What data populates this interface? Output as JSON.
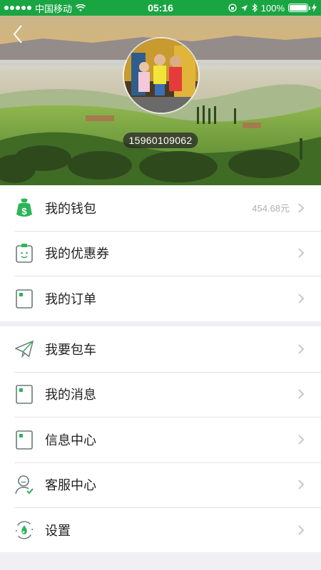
{
  "status_bar": {
    "carrier": "中国移动",
    "time": "05:16",
    "battery": "100%"
  },
  "profile": {
    "phone": "15960109062"
  },
  "menu_group_1": [
    {
      "label": "我的钱包",
      "value": "454.68元",
      "icon": "wallet-icon"
    },
    {
      "label": "我的优惠券",
      "value": "",
      "icon": "coupon-icon"
    },
    {
      "label": "我的订单",
      "value": "",
      "icon": "order-icon"
    }
  ],
  "menu_group_2": [
    {
      "label": "我要包车",
      "value": "",
      "icon": "paper-plane-icon"
    },
    {
      "label": "我的消息",
      "value": "",
      "icon": "message-icon"
    },
    {
      "label": "信息中心",
      "value": "",
      "icon": "info-center-icon"
    },
    {
      "label": "客服中心",
      "value": "",
      "icon": "customer-service-icon"
    },
    {
      "label": "设置",
      "value": "",
      "icon": "settings-icon"
    }
  ],
  "colors": {
    "accent_green": "#1aa543",
    "icon_green": "#2db45a"
  }
}
